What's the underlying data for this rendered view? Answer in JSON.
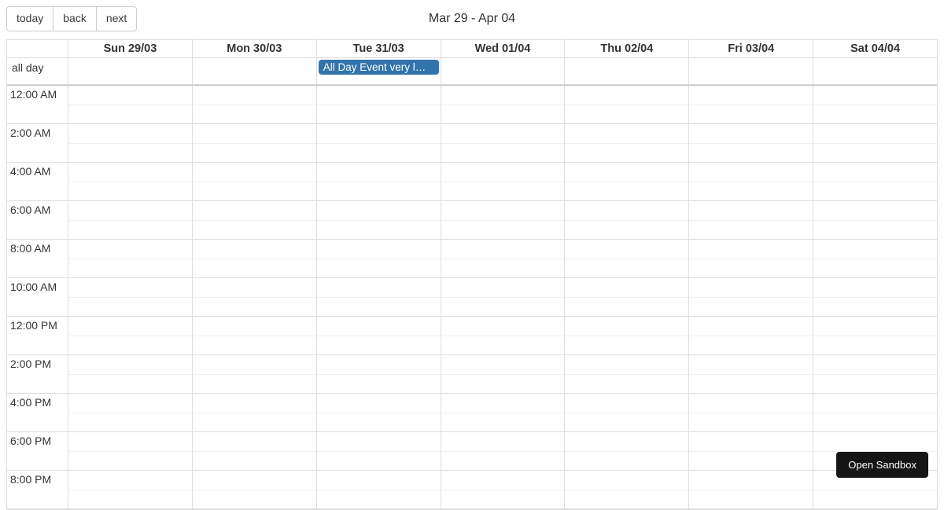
{
  "toolbar": {
    "today_label": "today",
    "back_label": "back",
    "next_label": "next",
    "title": "Mar 29 - Apr 04"
  },
  "calendar": {
    "allday_label": "all day",
    "days": [
      {
        "header": "Sun 29/03"
      },
      {
        "header": "Mon 30/03"
      },
      {
        "header": "Tue 31/03"
      },
      {
        "header": "Wed 01/04"
      },
      {
        "header": "Thu 02/04"
      },
      {
        "header": "Fri 03/04"
      },
      {
        "header": "Sat 04/04"
      }
    ],
    "time_labels": [
      "12:00 AM",
      "2:00 AM",
      "4:00 AM",
      "6:00 AM",
      "8:00 AM",
      "10:00 AM",
      "12:00 PM",
      "2:00 PM",
      "4:00 PM",
      "6:00 PM",
      "8:00 PM"
    ],
    "events": {
      "allday": {
        "day_index": 2,
        "title": "All Day Event very l…"
      }
    }
  },
  "sandbox": {
    "button_label": "Open Sandbox"
  },
  "colors": {
    "event_bg": "#3174ad"
  }
}
